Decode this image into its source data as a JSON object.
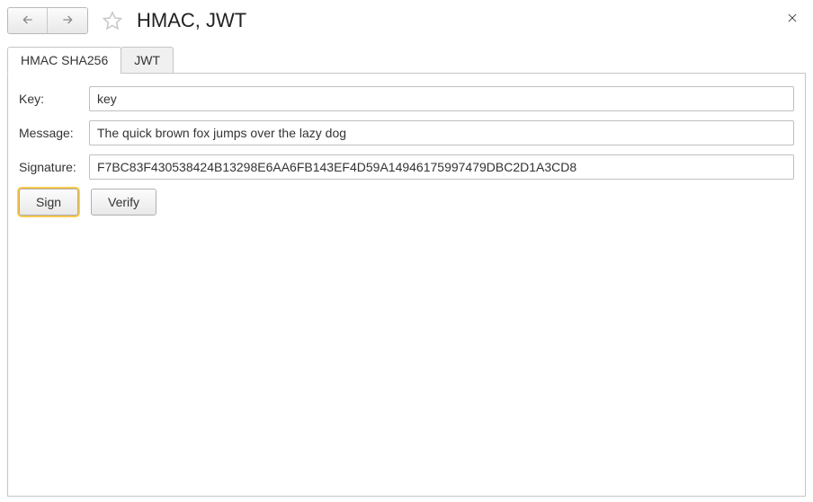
{
  "header": {
    "title": "HMAC, JWT"
  },
  "tabs": [
    {
      "label": "HMAC SHA256",
      "active": true
    },
    {
      "label": "JWT",
      "active": false
    }
  ],
  "form": {
    "key_label": "Key:",
    "key_value": "key",
    "message_label": "Message:",
    "message_value": "The quick brown fox jumps over the lazy dog",
    "signature_label": "Signature:",
    "signature_value": "F7BC83F430538424B13298E6AA6FB143EF4D59A14946175997479DBC2D1A3CD8"
  },
  "buttons": {
    "sign": "Sign",
    "verify": "Verify"
  }
}
